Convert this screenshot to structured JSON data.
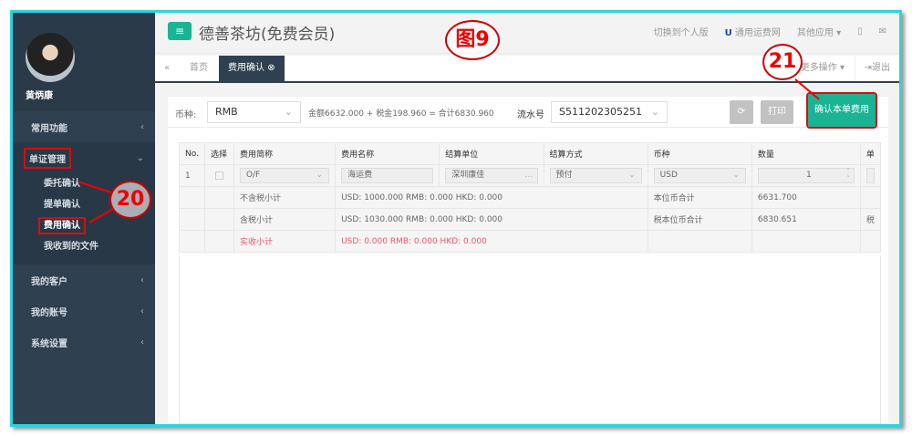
{
  "sidebar": {
    "user_name": "黄炳康",
    "items": [
      {
        "label": "常用功能"
      },
      {
        "label": "单证管理"
      },
      {
        "label": "我的客户"
      },
      {
        "label": "我的账号"
      },
      {
        "label": "系统设置"
      }
    ],
    "sub_items": [
      {
        "label": "委托确认"
      },
      {
        "label": "提单确认"
      },
      {
        "label": "费用确认"
      },
      {
        "label": "我收到的文件"
      }
    ]
  },
  "header": {
    "title": "德善茶坊(免费会员)",
    "links": [
      "切换到个人版",
      "通用运费网",
      "其他应用"
    ]
  },
  "tabs": {
    "home": "首页",
    "active": "费用确认",
    "more": "更多操作",
    "logout": "退出"
  },
  "toolbar": {
    "currency_label": "币种:",
    "currency_value": "RMB",
    "summary": "金额6632.000 + 税金198.960 = 合计6830.960",
    "serial_label": "流水号",
    "serial_value": "S511202305251",
    "print": "打印",
    "confirm": "确认本单费用"
  },
  "table": {
    "headers": [
      "No.",
      "选择",
      "费用简称",
      "费用名称",
      "结算单位",
      "结算方式",
      "币种",
      "数量",
      "单"
    ],
    "row": {
      "no": "1",
      "short": "O/F",
      "name": "海运费",
      "unit": "深圳康佳",
      "method": "预付",
      "currency": "USD",
      "qty": "1"
    },
    "subtotals": [
      {
        "label": "不含税小计",
        "value": "USD: 1000.000   RMB: 0.000   HKD: 0.000",
        "label2": "本位币合计",
        "value2": "6631.700",
        "extra": ""
      },
      {
        "label": "含税小计",
        "value": "USD: 1030.000   RMB: 0.000   HKD: 0.000",
        "label2": "税本位币合计",
        "value2": "6830.651",
        "extra": "税"
      },
      {
        "label": "实收小计",
        "value": "USD: 0.000   RMB: 0.000   HKD: 0.000",
        "label2": "",
        "value2": "",
        "extra": ""
      }
    ]
  },
  "annotations": {
    "figure": "图9",
    "step20": "20",
    "step21": "21"
  },
  "colors": {
    "accent": "#1ab394",
    "sidebar": "#2f4050",
    "annotation": "#e00000",
    "frame": "#2ad4e0"
  }
}
